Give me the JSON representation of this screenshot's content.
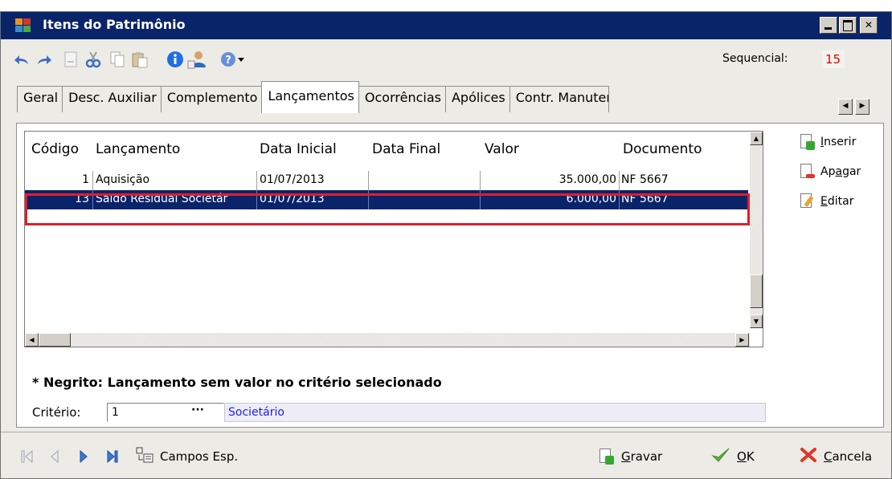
{
  "window": {
    "title": "Itens do Patrimônio"
  },
  "toolbar": {
    "sequencial_label": "Sequencial:",
    "sequencial_value": "15",
    "icons": [
      "undo-icon",
      "redo-icon",
      "new-document-icon",
      "cut-icon",
      "copy-icon",
      "paste-icon",
      "info-icon",
      "user-icon",
      "help-icon",
      "dropdown-arrow-icon"
    ]
  },
  "tabs": [
    {
      "label": "Geral"
    },
    {
      "label": "Desc. Auxiliar"
    },
    {
      "label": "Complemento"
    },
    {
      "label": "Lançamentos"
    },
    {
      "label": "Ocorrências"
    },
    {
      "label": "Apólices"
    },
    {
      "label": "Contr. Manutençã"
    }
  ],
  "active_tab": "Lançamentos",
  "grid": {
    "columns": [
      "Código",
      "Lançamento",
      "Data Inicial",
      "Data Final",
      "Valor",
      "Documento"
    ],
    "rows": [
      {
        "codigo": "1",
        "lancamento": "Aquisição",
        "data_inicial": "01/07/2013",
        "data_final": "",
        "valor": "35.000,00",
        "documento": "NF 5667"
      },
      {
        "codigo": "13",
        "lancamento": "Saldo Residual Societár",
        "data_inicial": "01/07/2013",
        "data_final": "",
        "valor": "6.000,00",
        "documento": "NF 5667"
      }
    ],
    "selected_row": 2
  },
  "actions": {
    "inserir": {
      "prefix": "",
      "underline": "I",
      "rest": "nserir"
    },
    "apagar": {
      "prefix": "Ap",
      "underline": "a",
      "rest": "gar"
    },
    "editar": {
      "prefix": "",
      "underline": "E",
      "rest": "ditar"
    }
  },
  "note": "* Negrito: Lançamento sem valor no critério selecionado",
  "criterio": {
    "label": "Critério:",
    "value": "1",
    "button": "···",
    "description": "Societário"
  },
  "bottom": {
    "campos_esp": "Campos Esp.",
    "gravar": {
      "underline": "G",
      "rest": "ravar"
    },
    "ok": {
      "underline": "O",
      "rest": "K"
    },
    "cancela": {
      "underline": "C",
      "rest": "ancela"
    }
  },
  "colors": {
    "titlebar": "#0a246a",
    "selection": "#0a246a",
    "highlight_box": "#e01e2a",
    "sequencial_value": "#e00000",
    "criterio_desc": "#1d1df5"
  }
}
